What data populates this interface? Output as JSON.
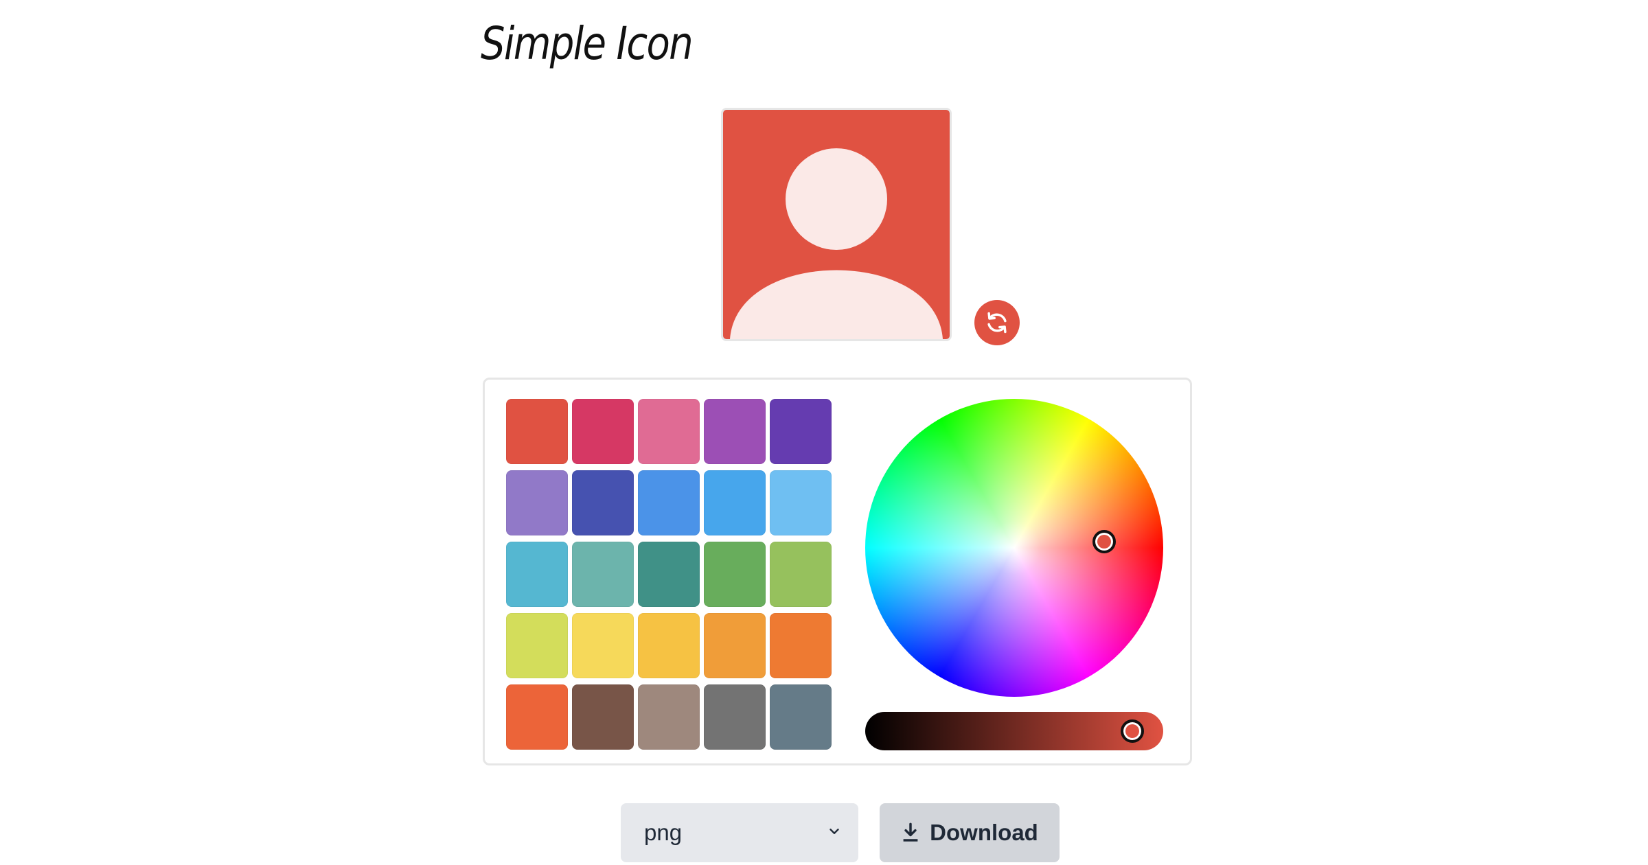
{
  "app": {
    "title": "Simple Icon"
  },
  "colors": {
    "selected": "#e05242",
    "icon_foreground": "#fbe9e7",
    "regen_icon": "#ffffff"
  },
  "icons": {
    "avatar": "person-avatar-icon",
    "regenerate": "refresh-icon",
    "download": "download-icon",
    "dropdown": "chevron-down-icon"
  },
  "palette": [
    [
      "#e05242",
      "#d63864",
      "#e06b94",
      "#9c4fb5",
      "#653cb0"
    ],
    [
      "#9179c8",
      "#4652b0",
      "#4b93e8",
      "#47a6ec",
      "#6fbff2"
    ],
    [
      "#55b7d1",
      "#6cb4ac",
      "#409187",
      "#68ad5c",
      "#96c15d"
    ],
    [
      "#d3dd5b",
      "#f6d95a",
      "#f6c243",
      "#f09d39",
      "#ee7a32"
    ],
    [
      "#ec6439",
      "#785548",
      "#9e887d",
      "#737373",
      "#657b88"
    ]
  ],
  "controls": {
    "format": "png",
    "download_label": "Download"
  }
}
